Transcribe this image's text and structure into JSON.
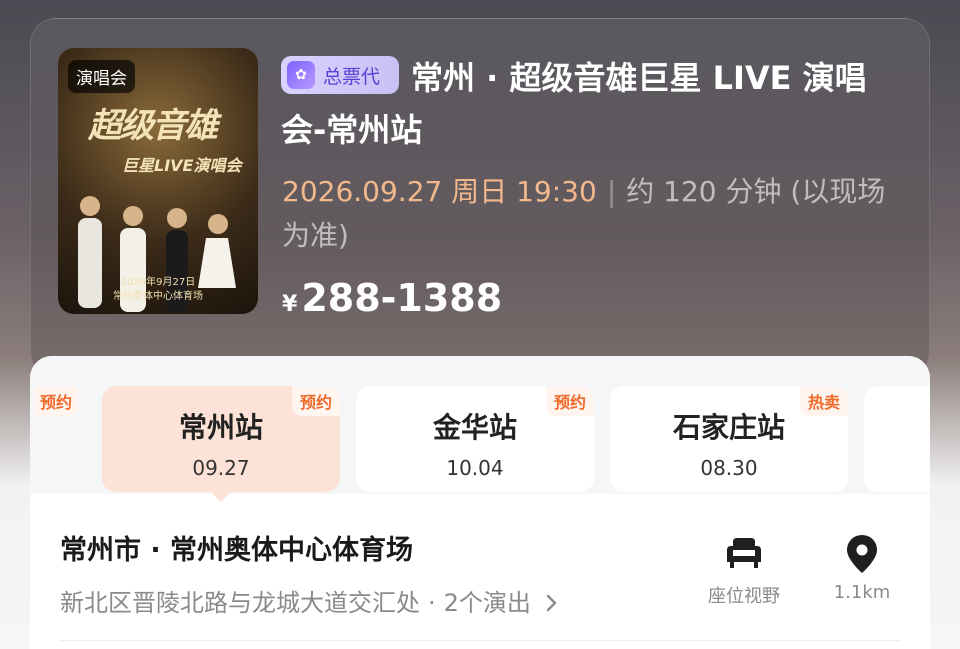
{
  "poster": {
    "tag": "演唱会",
    "title_art": "超级音雄",
    "sub_art": "巨星LIVE演唱会",
    "date_art": "2026年9月27日",
    "venue_art": "常州奥体中心体育场"
  },
  "event": {
    "agent_badge": "总票代",
    "title": "常州 · 超级音雄巨星 LIVE 演唱会-常州站",
    "datetime": "2026.09.27 周日 19:30",
    "duration": "约 120 分钟 (以现场为准)",
    "price_symbol": "¥",
    "price_range": "288-1388"
  },
  "stops": {
    "edge_left_badge": "预约",
    "items": [
      {
        "name": "常州站",
        "date": "09.27",
        "badge": "预约",
        "active": true
      },
      {
        "name": "金华站",
        "date": "10.04",
        "badge": "预约",
        "active": false
      },
      {
        "name": "石家庄站",
        "date": "08.30",
        "badge": "热卖",
        "active": false
      }
    ]
  },
  "venue": {
    "name": "常州市 · 常州奥体中心体育场",
    "address": "新北区晋陵北路与龙城大道交汇处",
    "shows": "2个演出",
    "seat_view_label": "座位视野",
    "distance": "1.1km"
  },
  "colors": {
    "accent_orange": "#ef6a2b",
    "price_date": "#f3b88d",
    "agent_purple": "#5b3fd6"
  },
  "icons": {
    "seat": "armchair-icon",
    "location": "map-pin-icon",
    "chevron": "chevron-right-icon"
  }
}
